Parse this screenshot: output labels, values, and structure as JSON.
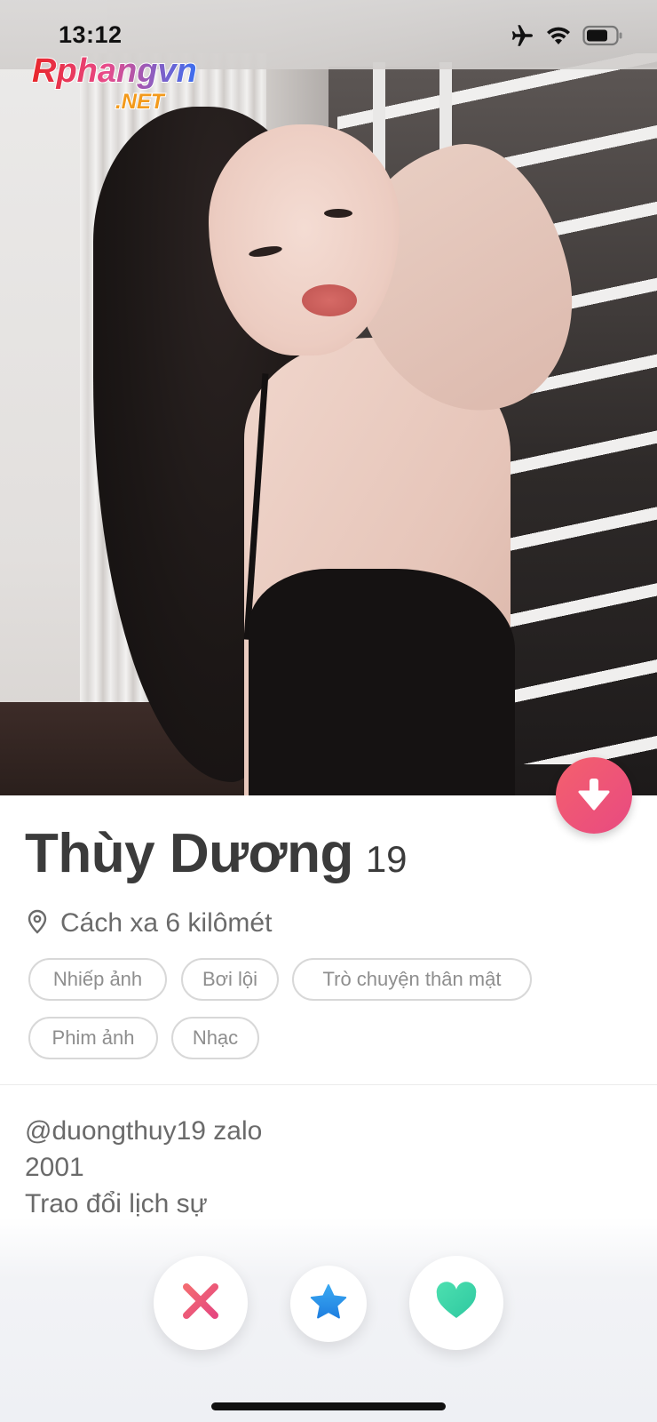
{
  "status_bar": {
    "time": "13:12",
    "icons": [
      "airplane-icon",
      "wifi-icon",
      "battery-icon"
    ]
  },
  "watermark": {
    "brand": "Rphangvn",
    "suffix": ".NET"
  },
  "profile": {
    "name": "Thùy Dương",
    "age": "19",
    "distance": "Cách xa 6 kilômét",
    "interests": [
      "Nhiếp ảnh",
      "Bơi lội",
      "Trò chuyện thân mật",
      "Phim ảnh",
      "Nhạc"
    ],
    "bio_lines": [
      "@duongthuy19 zalo",
      "2001",
      "Trao đổi lịch sự"
    ]
  },
  "actions": {
    "collapse_icon": "arrow-down-icon",
    "nope_icon": "close-x-icon",
    "super_like_icon": "star-icon",
    "like_icon": "heart-icon"
  },
  "colors": {
    "accent_gradient_start": "#f4606d",
    "accent_gradient_end": "#e84a81",
    "nope": "#f06773",
    "super_like": "#2e9cf0",
    "like": "#3ad6a8"
  }
}
